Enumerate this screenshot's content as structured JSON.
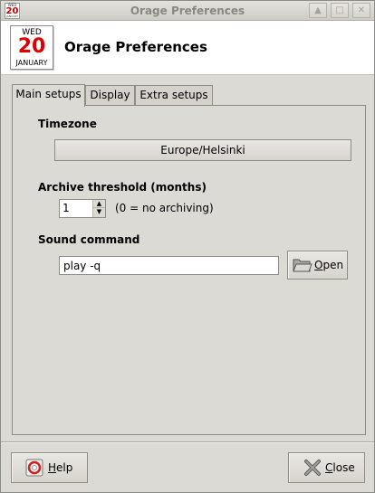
{
  "window": {
    "title": "Orage Preferences",
    "controls": [
      "maximize-up",
      "restore",
      "close"
    ]
  },
  "header": {
    "calendar_icon": {
      "weekday": "WED",
      "day": "20",
      "month": "JANUARY"
    },
    "title": "Orage Preferences"
  },
  "tabs": [
    {
      "label": "Main setups",
      "active": true
    },
    {
      "label": "Display",
      "active": false
    },
    {
      "label": "Extra setups",
      "active": false
    }
  ],
  "main_setups": {
    "timezone": {
      "title": "Timezone",
      "value": "Europe/Helsinki"
    },
    "archive": {
      "title": "Archive threshold (months)",
      "value": "1",
      "note": "(0 = no archiving)"
    },
    "sound": {
      "title": "Sound command",
      "value": "play -q",
      "open_label_first": "O",
      "open_label_rest": "pen"
    }
  },
  "footer": {
    "help_first": "H",
    "help_rest": "elp",
    "close_first": "C",
    "close_rest": "lose"
  },
  "colors": {
    "window_bg": "#dcdad5",
    "header_bg": "#ffffff",
    "calendar_day": "#dd0000"
  }
}
